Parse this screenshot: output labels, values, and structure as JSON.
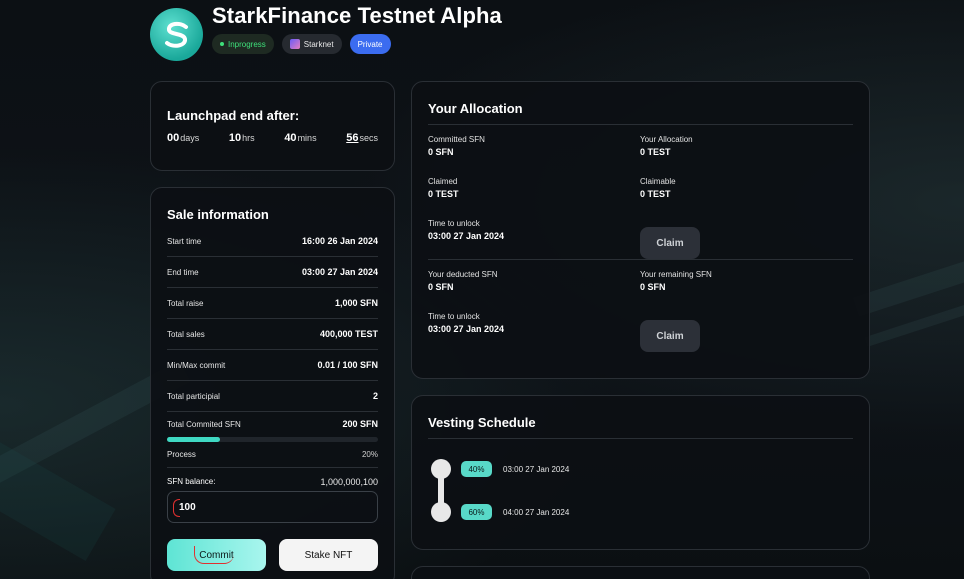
{
  "header": {
    "title": "StarkFinance Testnet Alpha",
    "badges": {
      "status": "Inprogress",
      "chain": "Starknet",
      "visibility": "Private"
    }
  },
  "countdown": {
    "heading": "Launchpad end after:",
    "days": "00",
    "days_unit": "days",
    "hrs": "10",
    "hrs_unit": "hrs",
    "mins": "40",
    "mins_unit": "mins",
    "secs": "56",
    "secs_unit": "secs"
  },
  "sale": {
    "heading": "Sale information",
    "rows": [
      {
        "label": "Start time",
        "value": "16:00 26 Jan 2024"
      },
      {
        "label": "End time",
        "value": "03:00 27 Jan 2024"
      },
      {
        "label": "Total raise",
        "value": "1,000 SFN"
      },
      {
        "label": "Total sales",
        "value": "400,000 TEST"
      },
      {
        "label": "Min/Max commit",
        "value": "0.01 / 100 SFN"
      },
      {
        "label": "Total participial",
        "value": "2"
      },
      {
        "label": "Total Commited SFN",
        "value": "200 SFN"
      }
    ],
    "progress_fraction": 0.25,
    "process_label": "Process",
    "process_value": "20%",
    "balance_label": "SFN balance:",
    "balance_value": "1,000,000,100",
    "input_value": "100",
    "commit_label": "Commit",
    "stake_label": "Stake NFT"
  },
  "allocation": {
    "heading": "Your Allocation",
    "committed_label": "Committed SFN",
    "committed_value": "0 SFN",
    "your_alloc_label": "Your Allocation",
    "your_alloc_value": "0 TEST",
    "claimed_label": "Claimed",
    "claimed_value": "0 TEST",
    "claimable_label": "Claimable",
    "claimable_value": "0 TEST",
    "unlock1_label": "Time to unlock",
    "unlock1_value": "03:00 27 Jan 2024",
    "claim_label": "Claim",
    "deducted_label": "Your deducted SFN",
    "deducted_value": "0 SFN",
    "remaining_label": "Your remaining SFN",
    "remaining_value": "0 SFN",
    "unlock2_label": "Time to unlock",
    "unlock2_value": "03:00 27 Jan 2024"
  },
  "vesting": {
    "heading": "Vesting Schedule",
    "items": [
      {
        "percent": "40%",
        "date": "03:00 27 Jan 2024"
      },
      {
        "percent": "60%",
        "date": "04:00 27 Jan 2024"
      }
    ]
  },
  "colors": {
    "accent": "#3fd8c2",
    "private_badge": "#3b6cf0",
    "inprogress": "#3ee07a"
  }
}
